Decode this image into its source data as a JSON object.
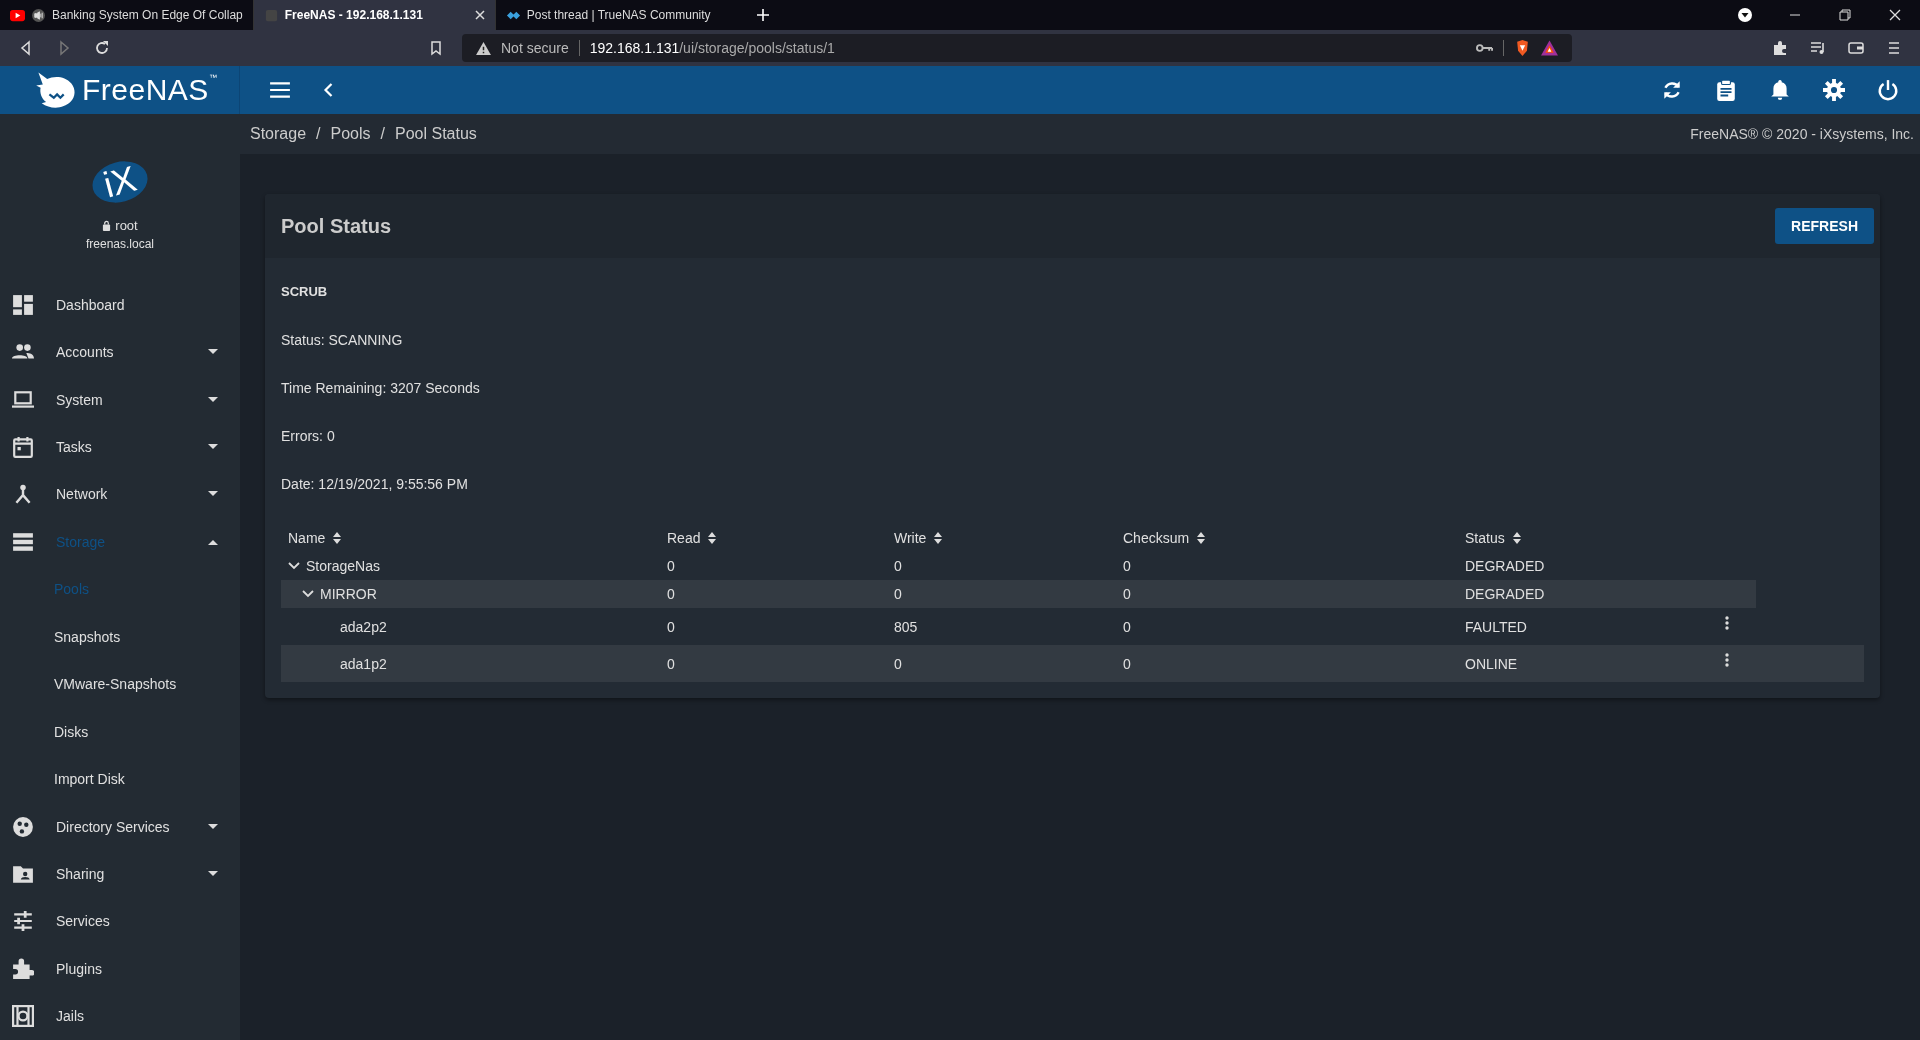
{
  "browser": {
    "tabs": [
      {
        "title": "Banking System On Edge Of Collap",
        "kind": "video",
        "audio": true,
        "selected": false
      },
      {
        "title": "FreeNAS - 192.168.1.131",
        "kind": "page",
        "audio": false,
        "selected": true
      },
      {
        "title": "Post thread | TrueNAS Community",
        "kind": "forum",
        "audio": false,
        "selected": false
      }
    ],
    "security": "Not secure",
    "url_host": "192.168.1.131",
    "url_path": "/ui/storage/pools/status/1"
  },
  "header": {
    "logo": "FreeNAS",
    "trademark": "™"
  },
  "user": {
    "name": "root",
    "host": "freenas.local",
    "logo": "iX"
  },
  "sidebar": {
    "items": [
      {
        "label": "Dashboard",
        "selected": false
      },
      {
        "label": "Accounts",
        "expanded": false,
        "selected": false
      },
      {
        "label": "System",
        "expanded": false,
        "selected": false
      },
      {
        "label": "Tasks",
        "expanded": false,
        "selected": false
      },
      {
        "label": "Network",
        "expanded": false,
        "selected": false
      },
      {
        "label": "Storage",
        "expanded": true,
        "selected": true,
        "children": [
          {
            "label": "Pools",
            "selected": true
          },
          {
            "label": "Snapshots",
            "selected": false
          },
          {
            "label": "VMware-Snapshots",
            "selected": false
          },
          {
            "label": "Disks",
            "selected": false
          },
          {
            "label": "Import Disk",
            "selected": false
          }
        ]
      },
      {
        "label": "Directory Services",
        "expanded": false,
        "selected": false
      },
      {
        "label": "Sharing",
        "expanded": false,
        "selected": false
      },
      {
        "label": "Services",
        "selected": false
      },
      {
        "label": "Plugins",
        "selected": false
      },
      {
        "label": "Jails",
        "selected": false
      }
    ]
  },
  "breadcrumb": [
    "Storage",
    "Pools",
    "Pool Status"
  ],
  "breadcrumb_separator": "/",
  "copyright": "FreeNAS® © 2020 - iXsystems, Inc.",
  "card": {
    "title": "Pool Status",
    "refresh_button": "REFRESH",
    "section": "SCRUB",
    "details": [
      "Status: SCANNING",
      "Time Remaining: 3207 Seconds",
      "Errors: 0",
      "Date: 12/19/2021, 9:55:56 PM"
    ],
    "table": {
      "columns": [
        "Name",
        "Read",
        "Write",
        "Checksum",
        "Status"
      ],
      "rows": [
        {
          "name": "StorageNas",
          "read": "0",
          "write": "0",
          "checksum": "0",
          "status": "DEGRADED",
          "expanded": true,
          "highlighted": false,
          "menu": false,
          "children": [
            {
              "name": "MIRROR",
              "read": "0",
              "write": "0",
              "checksum": "0",
              "status": "DEGRADED",
              "expanded": true,
              "highlighted": true,
              "menu": false,
              "children": [
                {
                  "name": "ada2p2",
                  "read": "0",
                  "write": "805",
                  "checksum": "0",
                  "status": "FAULTED",
                  "highlighted": false,
                  "menu": true
                },
                {
                  "name": "ada1p2",
                  "read": "0",
                  "write": "0",
                  "checksum": "0",
                  "status": "ONLINE",
                  "highlighted": true,
                  "menu": true
                }
              ]
            }
          ]
        }
      ]
    }
  }
}
